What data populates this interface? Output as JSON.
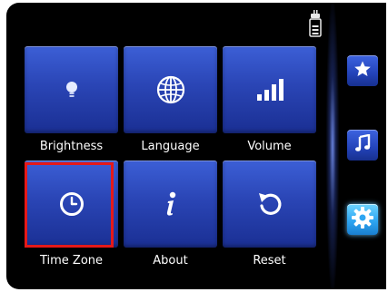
{
  "tiles": [
    {
      "label": "Brightness",
      "icon": "bulb-icon"
    },
    {
      "label": "Language",
      "icon": "globe-icon"
    },
    {
      "label": "Volume",
      "icon": "volume-bars-icon"
    },
    {
      "label": "Time Zone",
      "icon": "clock-icon"
    },
    {
      "label": "About",
      "icon": "info-icon"
    },
    {
      "label": "Reset",
      "icon": "reset-arrow-icon"
    }
  ],
  "selected_tile": "Time Zone",
  "sidebar": [
    {
      "icon": "star-icon",
      "active": false
    },
    {
      "icon": "music-note-icon",
      "active": false
    },
    {
      "icon": "gear-icon",
      "active": true
    }
  ],
  "status": {
    "icon": "battery-plug-icon"
  },
  "colors": {
    "tile": "#2a45b5",
    "selection": "#e61919",
    "sidebar_active": "#2ea6f2",
    "background": "#000000"
  }
}
